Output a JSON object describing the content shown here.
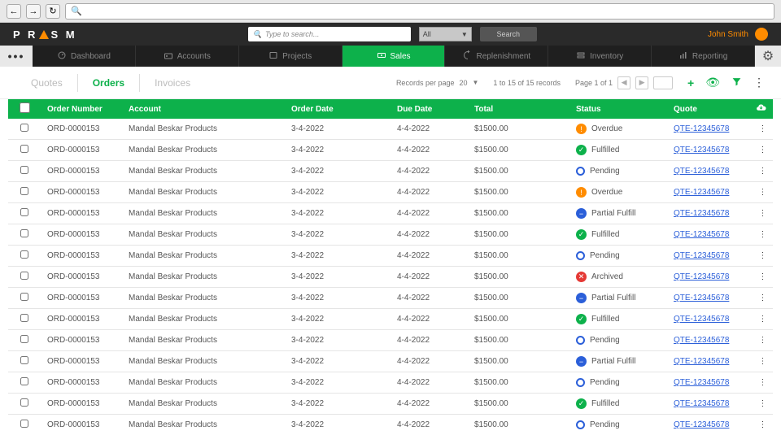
{
  "browser": {
    "url_hint": "Q"
  },
  "header": {
    "logo_pre": "P R",
    "logo_post": "S M",
    "search_placeholder": "Type to search...",
    "filter_label": "All",
    "search_btn": "Search",
    "user_name": "John Smith"
  },
  "main_nav": [
    {
      "label": "Dashboard",
      "icon": "dashboard"
    },
    {
      "label": "Accounts",
      "icon": "accounts"
    },
    {
      "label": "Projects",
      "icon": "projects"
    },
    {
      "label": "Sales",
      "icon": "sales",
      "active": true
    },
    {
      "label": "Replenishment",
      "icon": "replenish"
    },
    {
      "label": "Inventory",
      "icon": "inventory"
    },
    {
      "label": "Reporting",
      "icon": "reporting"
    }
  ],
  "sub_tabs": [
    {
      "label": "Quotes"
    },
    {
      "label": "Orders",
      "active": true
    },
    {
      "label": "Invoices"
    }
  ],
  "toolbar": {
    "rpp_label": "Records per page",
    "rpp_value": "20",
    "records_text": "1 to 15 of 15 records",
    "page_text": "Page 1 of 1"
  },
  "columns": {
    "check": "",
    "order_number": "Order Number",
    "account": "Account",
    "order_date": "Order Date",
    "due_date": "Due Date",
    "total": "Total",
    "status": "Status",
    "quote": "Quote"
  },
  "rows": [
    {
      "order": "ORD-0000153",
      "account": "Mandal Beskar Products",
      "odate": "3-4-2022",
      "ddate": "4-4-2022",
      "total": "$1500.00",
      "status": "Overdue",
      "stype": "overdue",
      "quote": "QTE-12345678"
    },
    {
      "order": "ORD-0000153",
      "account": "Mandal Beskar Products",
      "odate": "3-4-2022",
      "ddate": "4-4-2022",
      "total": "$1500.00",
      "status": "Fulfilled",
      "stype": "fulfilled",
      "quote": "QTE-12345678"
    },
    {
      "order": "ORD-0000153",
      "account": "Mandal Beskar Products",
      "odate": "3-4-2022",
      "ddate": "4-4-2022",
      "total": "$1500.00",
      "status": "Pending",
      "stype": "pending",
      "quote": "QTE-12345678"
    },
    {
      "order": "ORD-0000153",
      "account": "Mandal Beskar Products",
      "odate": "3-4-2022",
      "ddate": "4-4-2022",
      "total": "$1500.00",
      "status": "Overdue",
      "stype": "overdue",
      "quote": "QTE-12345678"
    },
    {
      "order": "ORD-0000153",
      "account": "Mandal Beskar Products",
      "odate": "3-4-2022",
      "ddate": "4-4-2022",
      "total": "$1500.00",
      "status": "Partial Fulfill",
      "stype": "partial",
      "quote": "QTE-12345678"
    },
    {
      "order": "ORD-0000153",
      "account": "Mandal Beskar Products",
      "odate": "3-4-2022",
      "ddate": "4-4-2022",
      "total": "$1500.00",
      "status": "Fulfilled",
      "stype": "fulfilled",
      "quote": "QTE-12345678"
    },
    {
      "order": "ORD-0000153",
      "account": "Mandal Beskar Products",
      "odate": "3-4-2022",
      "ddate": "4-4-2022",
      "total": "$1500.00",
      "status": "Pending",
      "stype": "pending",
      "quote": "QTE-12345678"
    },
    {
      "order": "ORD-0000153",
      "account": "Mandal Beskar Products",
      "odate": "3-4-2022",
      "ddate": "4-4-2022",
      "total": "$1500.00",
      "status": "Archived",
      "stype": "archived",
      "quote": "QTE-12345678"
    },
    {
      "order": "ORD-0000153",
      "account": "Mandal Beskar Products",
      "odate": "3-4-2022",
      "ddate": "4-4-2022",
      "total": "$1500.00",
      "status": "Partial Fulfill",
      "stype": "partial",
      "quote": "QTE-12345678"
    },
    {
      "order": "ORD-0000153",
      "account": "Mandal Beskar Products",
      "odate": "3-4-2022",
      "ddate": "4-4-2022",
      "total": "$1500.00",
      "status": "Fulfilled",
      "stype": "fulfilled",
      "quote": "QTE-12345678"
    },
    {
      "order": "ORD-0000153",
      "account": "Mandal Beskar Products",
      "odate": "3-4-2022",
      "ddate": "4-4-2022",
      "total": "$1500.00",
      "status": "Pending",
      "stype": "pending",
      "quote": "QTE-12345678"
    },
    {
      "order": "ORD-0000153",
      "account": "Mandal Beskar Products",
      "odate": "3-4-2022",
      "ddate": "4-4-2022",
      "total": "$1500.00",
      "status": "Partial Fulfill",
      "stype": "partial",
      "quote": "QTE-12345678"
    },
    {
      "order": "ORD-0000153",
      "account": "Mandal Beskar Products",
      "odate": "3-4-2022",
      "ddate": "4-4-2022",
      "total": "$1500.00",
      "status": "Pending",
      "stype": "pending",
      "quote": "QTE-12345678"
    },
    {
      "order": "ORD-0000153",
      "account": "Mandal Beskar Products",
      "odate": "3-4-2022",
      "ddate": "4-4-2022",
      "total": "$1500.00",
      "status": "Fulfilled",
      "stype": "fulfilled",
      "quote": "QTE-12345678"
    },
    {
      "order": "ORD-0000153",
      "account": "Mandal Beskar Products",
      "odate": "3-4-2022",
      "ddate": "4-4-2022",
      "total": "$1500.00",
      "status": "Pending",
      "stype": "pending",
      "quote": "QTE-12345678"
    }
  ]
}
